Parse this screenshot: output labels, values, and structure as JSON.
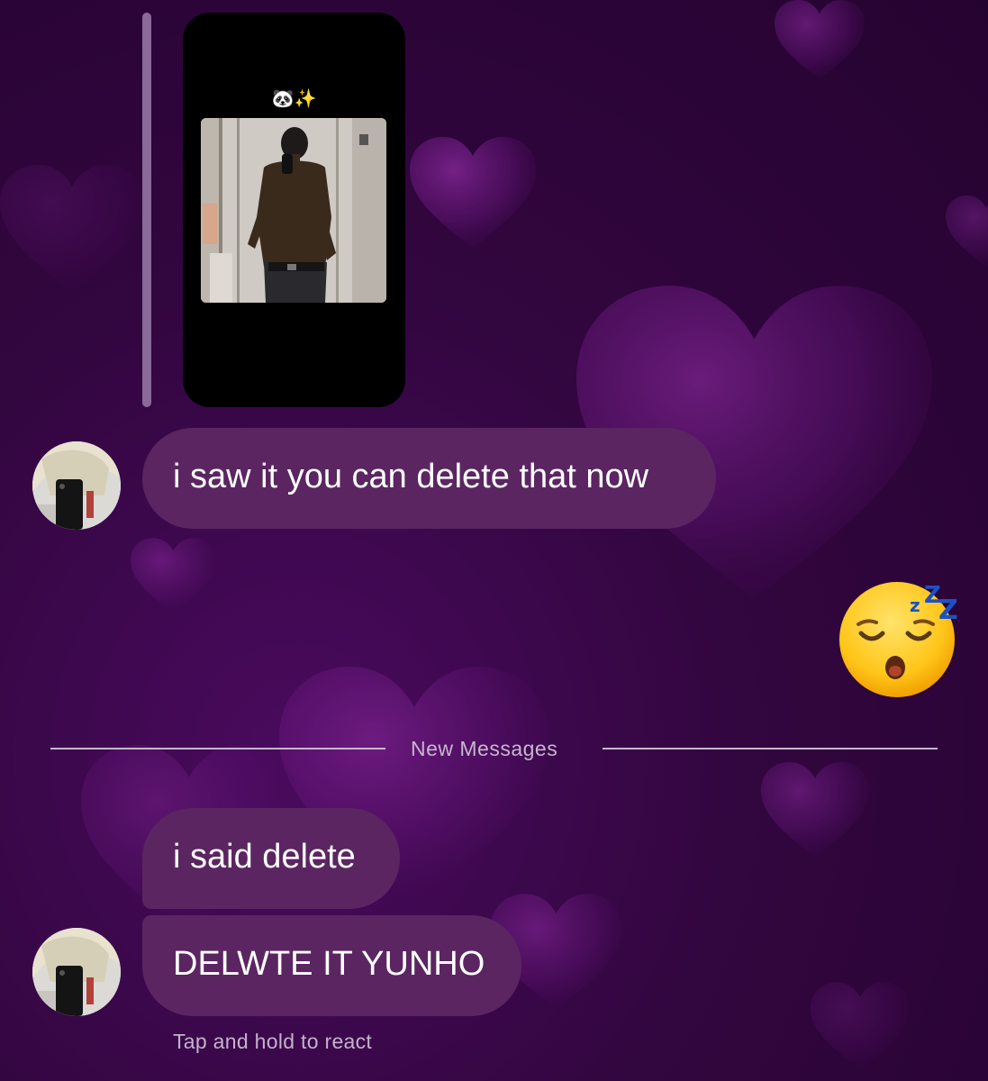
{
  "conversation": {
    "shared_post": {
      "caption": "🐼✨"
    },
    "messages": [
      {
        "text": "i saw it you can delete that now"
      },
      {
        "text": "i said delete"
      },
      {
        "text": "DELWTE IT YUNHO"
      }
    ],
    "reaction_emoji": "sleeping-face",
    "divider_label": "New Messages",
    "hint": "Tap and hold to react"
  },
  "theme": {
    "background": "#32063f",
    "bubble": "#5b2562",
    "divider": "#c7b6cf"
  }
}
